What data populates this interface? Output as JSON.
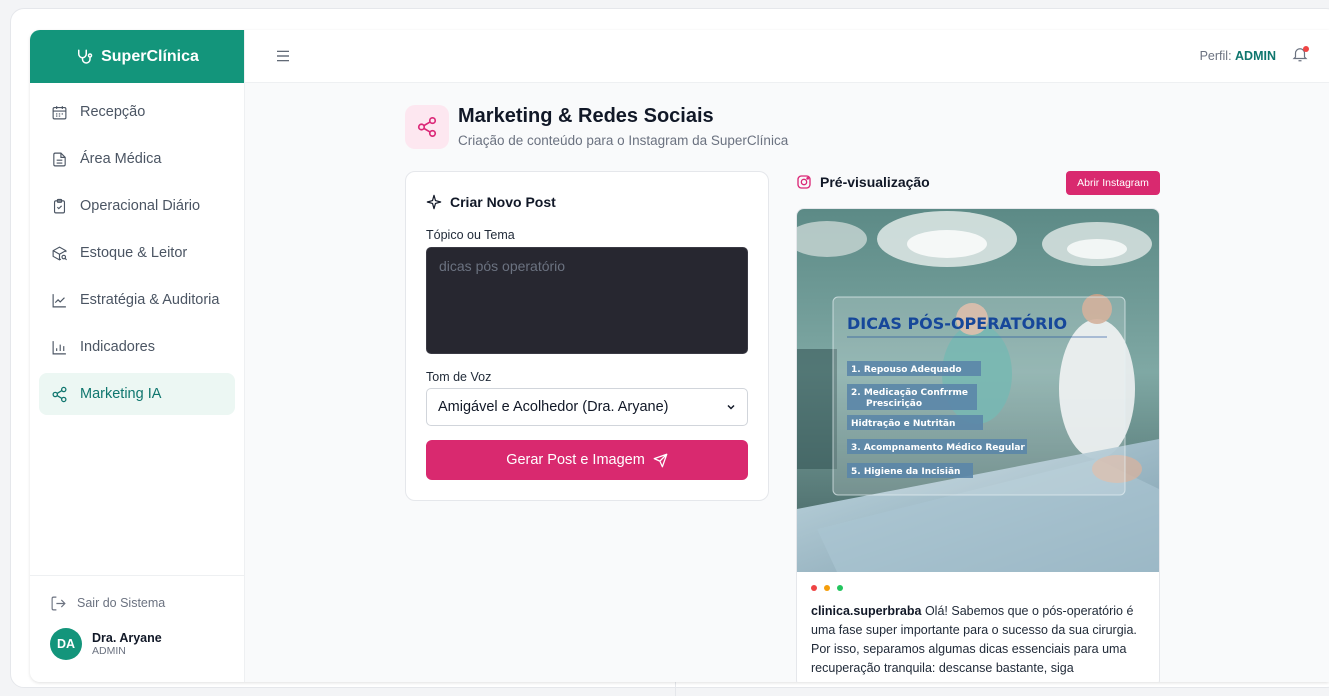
{
  "brand": {
    "name": "SuperClínica"
  },
  "sidebar": {
    "items": [
      {
        "label": "Recepção",
        "icon": "calendar-icon"
      },
      {
        "label": "Área Médica",
        "icon": "document-icon"
      },
      {
        "label": "Operacional Diário",
        "icon": "clipboard-check-icon"
      },
      {
        "label": "Estoque & Leitor",
        "icon": "package-search-icon"
      },
      {
        "label": "Estratégia & Auditoria",
        "icon": "line-chart-icon"
      },
      {
        "label": "Indicadores",
        "icon": "bar-chart-icon"
      },
      {
        "label": "Marketing IA",
        "icon": "share-icon",
        "active": true
      }
    ],
    "logout_label": "Sair do Sistema",
    "user": {
      "initials": "DA",
      "name": "Dra. Aryane",
      "role": "ADMIN"
    }
  },
  "topbar": {
    "profile_label": "Perfil:",
    "profile_value": "ADMIN"
  },
  "page": {
    "title": "Marketing & Redes Sociais",
    "subtitle": "Criação de conteúdo para o Instagram da SuperClínica"
  },
  "form": {
    "title": "Criar Novo Post",
    "topic_label": "Tópico ou Tema",
    "topic_placeholder": "dicas pós operatório",
    "tone_label": "Tom de Voz",
    "tone_value": "Amigável e Acolhedor (Dra. Aryane)",
    "generate_label": "Gerar Post e Imagem"
  },
  "preview": {
    "title": "Pré-visualização",
    "open_instagram_label": "Abrir Instagram",
    "image_title": "DICAS PÓS-OPERATÓRIO",
    "image_tips": [
      "1.  Repouso Adequado",
      "2.  Medicação Confrrme",
      "Prescirição",
      "Hidtração e Nutritãn",
      "3.  Acompnamento Médico Regular",
      "5.  Higiene da Incisiãn"
    ],
    "dot_colors": [
      "#ef4444",
      "#f59e0b",
      "#22c55e"
    ],
    "username": "clinica.superbraba",
    "caption": "Olá! Sabemos que o pós-operatório é uma fase super importante para o sucesso da sua cirurgia. Por isso, separamos algumas dicas essenciais para uma recuperação tranquila: descanse bastante, siga"
  },
  "colors": {
    "brand": "#13957b",
    "accent": "#d9296f"
  }
}
